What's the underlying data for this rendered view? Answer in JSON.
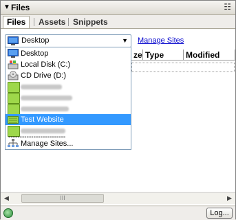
{
  "panel": {
    "title": "Files"
  },
  "tabs": [
    {
      "label": "Files",
      "active": true
    },
    {
      "label": "Assets",
      "active": false
    },
    {
      "label": "Snippets",
      "active": false
    }
  ],
  "site_select": {
    "value": "Desktop",
    "icon": "desktop-icon"
  },
  "manage_sites_link": "Manage Sites",
  "columns": [
    "ze",
    "Type",
    "Modified"
  ],
  "dropdown": {
    "options": [
      {
        "label": "Desktop",
        "icon": "desktop-icon",
        "selected": false
      },
      {
        "label": "Local Disk (C:)",
        "icon": "local-disk-icon",
        "selected": false
      },
      {
        "label": "CD Drive (D:)",
        "icon": "cd-drive-icon",
        "selected": false
      },
      {
        "label": "",
        "icon": "folder-icon",
        "blurred": true,
        "selected": false
      },
      {
        "label": "",
        "icon": "folder-icon",
        "blurred": true,
        "selected": false
      },
      {
        "label": "",
        "icon": "folder-icon",
        "blurred": true,
        "selected": false
      },
      {
        "label": "Test Website",
        "icon": "site-icon",
        "selected": true
      },
      {
        "label": "",
        "icon": "folder-icon",
        "blurred": true,
        "selected": false
      },
      {
        "label": "-------------------------",
        "icon": "separator-icon",
        "selected": false
      },
      {
        "label": "Manage Sites...",
        "icon": "site-tree-icon",
        "selected": false
      }
    ]
  },
  "statusbar": {
    "log_button": "Log..."
  },
  "colors": {
    "selection": "#3399ff",
    "link": "#0000cc",
    "folder": "#9ed84a"
  }
}
